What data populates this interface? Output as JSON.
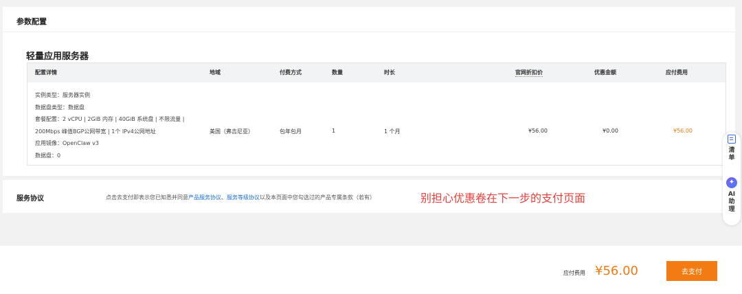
{
  "config": {
    "section_title": "参数配置",
    "product_title": "轻量应用服务器",
    "headers": {
      "detail": "配置详情",
      "region": "地域",
      "billing": "付费方式",
      "quantity": "数量",
      "duration": "时长",
      "list_price": "官网折扣价",
      "discount": "优惠金额",
      "payable": "应付费用"
    },
    "row": {
      "details": [
        "实例类型：服务器实例",
        "数据盘类型：数据盘",
        "套餐配置：2 vCPU | 2GiB 内存 | 40GiB 系统盘 | 不限流量 |",
        "200Mbps 峰值BGP公网带宽 | 1个 IPv4公网地址",
        "应用镜像：OpenClaw v3",
        "数据盘：0"
      ],
      "region": "美国（弗吉尼亚）",
      "billing": "包年包月",
      "quantity": "1",
      "duration": "1 个月",
      "list_price": "¥56.00",
      "discount": "¥0.00",
      "payable": "¥56.00"
    }
  },
  "agreement": {
    "label": "服务协议",
    "text_before": "点击去支付即表示您已知悉并同意",
    "link1": "产品服务协议",
    "sep": "、",
    "link2": "服务等级协议",
    "text_after": "以及本页面中您勾选过的产品专属条款（若有）",
    "note": "别担心优惠卷在下一步的支付页面"
  },
  "footer": {
    "payable_label": "应付费用",
    "payable_amount": "¥56.00",
    "pay_button": "去支付"
  },
  "floating": {
    "list_c1": "清",
    "list_c2": "单",
    "ai_c1": "AI",
    "ai_c2": "助",
    "ai_c3": "理",
    "list_icon": "list-icon",
    "ai_icon": "ai-assistant-icon"
  },
  "colors": {
    "accent": "#f27c11",
    "link": "#1a6fd6",
    "note": "#e8403a"
  }
}
